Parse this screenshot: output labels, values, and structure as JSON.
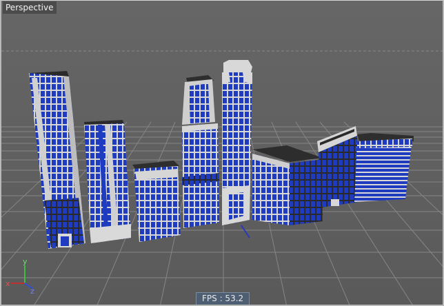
{
  "viewport": {
    "label": "Perspective",
    "fps_text": "FPS : 53.2",
    "axis": {
      "x_label": "x",
      "y_label": "y",
      "z_label": "z"
    }
  },
  "scene": {
    "icon": "city-buildings-icon",
    "building_colors": {
      "window_blue": "#1f3cc0",
      "frame_light": "#d9d9d9",
      "frame_dark": "#2f2f2f",
      "grid": "#8f8f8f",
      "sky_band": "#575757"
    }
  }
}
